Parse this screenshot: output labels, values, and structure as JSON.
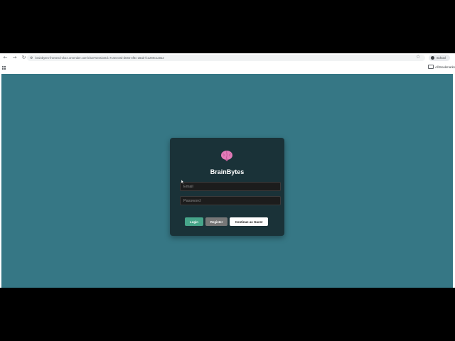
{
  "browser": {
    "url": "brainbytes-frontend-xk1e.onrender.com/chat?sessionId=7c4eec0d-d045-4f6c-a6ab-fc1269c1a0a2",
    "profile_label": "School",
    "all_bookmarks_label": "All Bookmarks",
    "icons": [
      "back-icon",
      "forward-icon",
      "reload-icon",
      "star-icon",
      "apps-icon",
      "folder-icon"
    ]
  },
  "app": {
    "background_color": "#367785",
    "card_color": "#1a3238",
    "brand": "BrainBytes",
    "logo_icon": "brain-icon",
    "email_placeholder": "Email",
    "password_placeholder": "Password",
    "login_label": "Login",
    "register_label": "Register",
    "guest_label": "Continue as Guest",
    "colors": {
      "login": "#47a58a",
      "register": "#777777",
      "guest": "#ffffff"
    }
  }
}
